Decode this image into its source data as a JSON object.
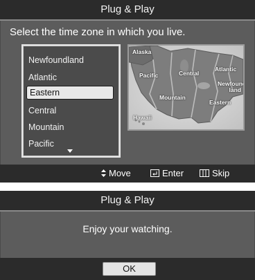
{
  "timezone_dialog": {
    "title": "Plug & Play",
    "prompt": "Select the time zone in which you live.",
    "zones": [
      "Newfoundland",
      "Atlantic",
      "Eastern",
      "Central",
      "Mountain",
      "Pacific"
    ],
    "selected": "Eastern",
    "map_labels": {
      "alaska": "Alaska",
      "pacific": "Pacific",
      "central": "Central",
      "atlantic": "Atlantic",
      "newfoundland": "Newfound-\nland",
      "mountain": "Mountain",
      "eastern": "Eastern",
      "hawaii": "Hawaii"
    },
    "hints": {
      "move": "Move",
      "enter": "Enter",
      "skip": "Skip"
    },
    "hint_icons": {
      "move": "up-down-arrow-icon",
      "enter": "enter-icon",
      "skip": "skip-icon"
    }
  },
  "finish_dialog": {
    "title": "Plug & Play",
    "message": "Enjoy your watching.",
    "ok_label": "OK"
  }
}
